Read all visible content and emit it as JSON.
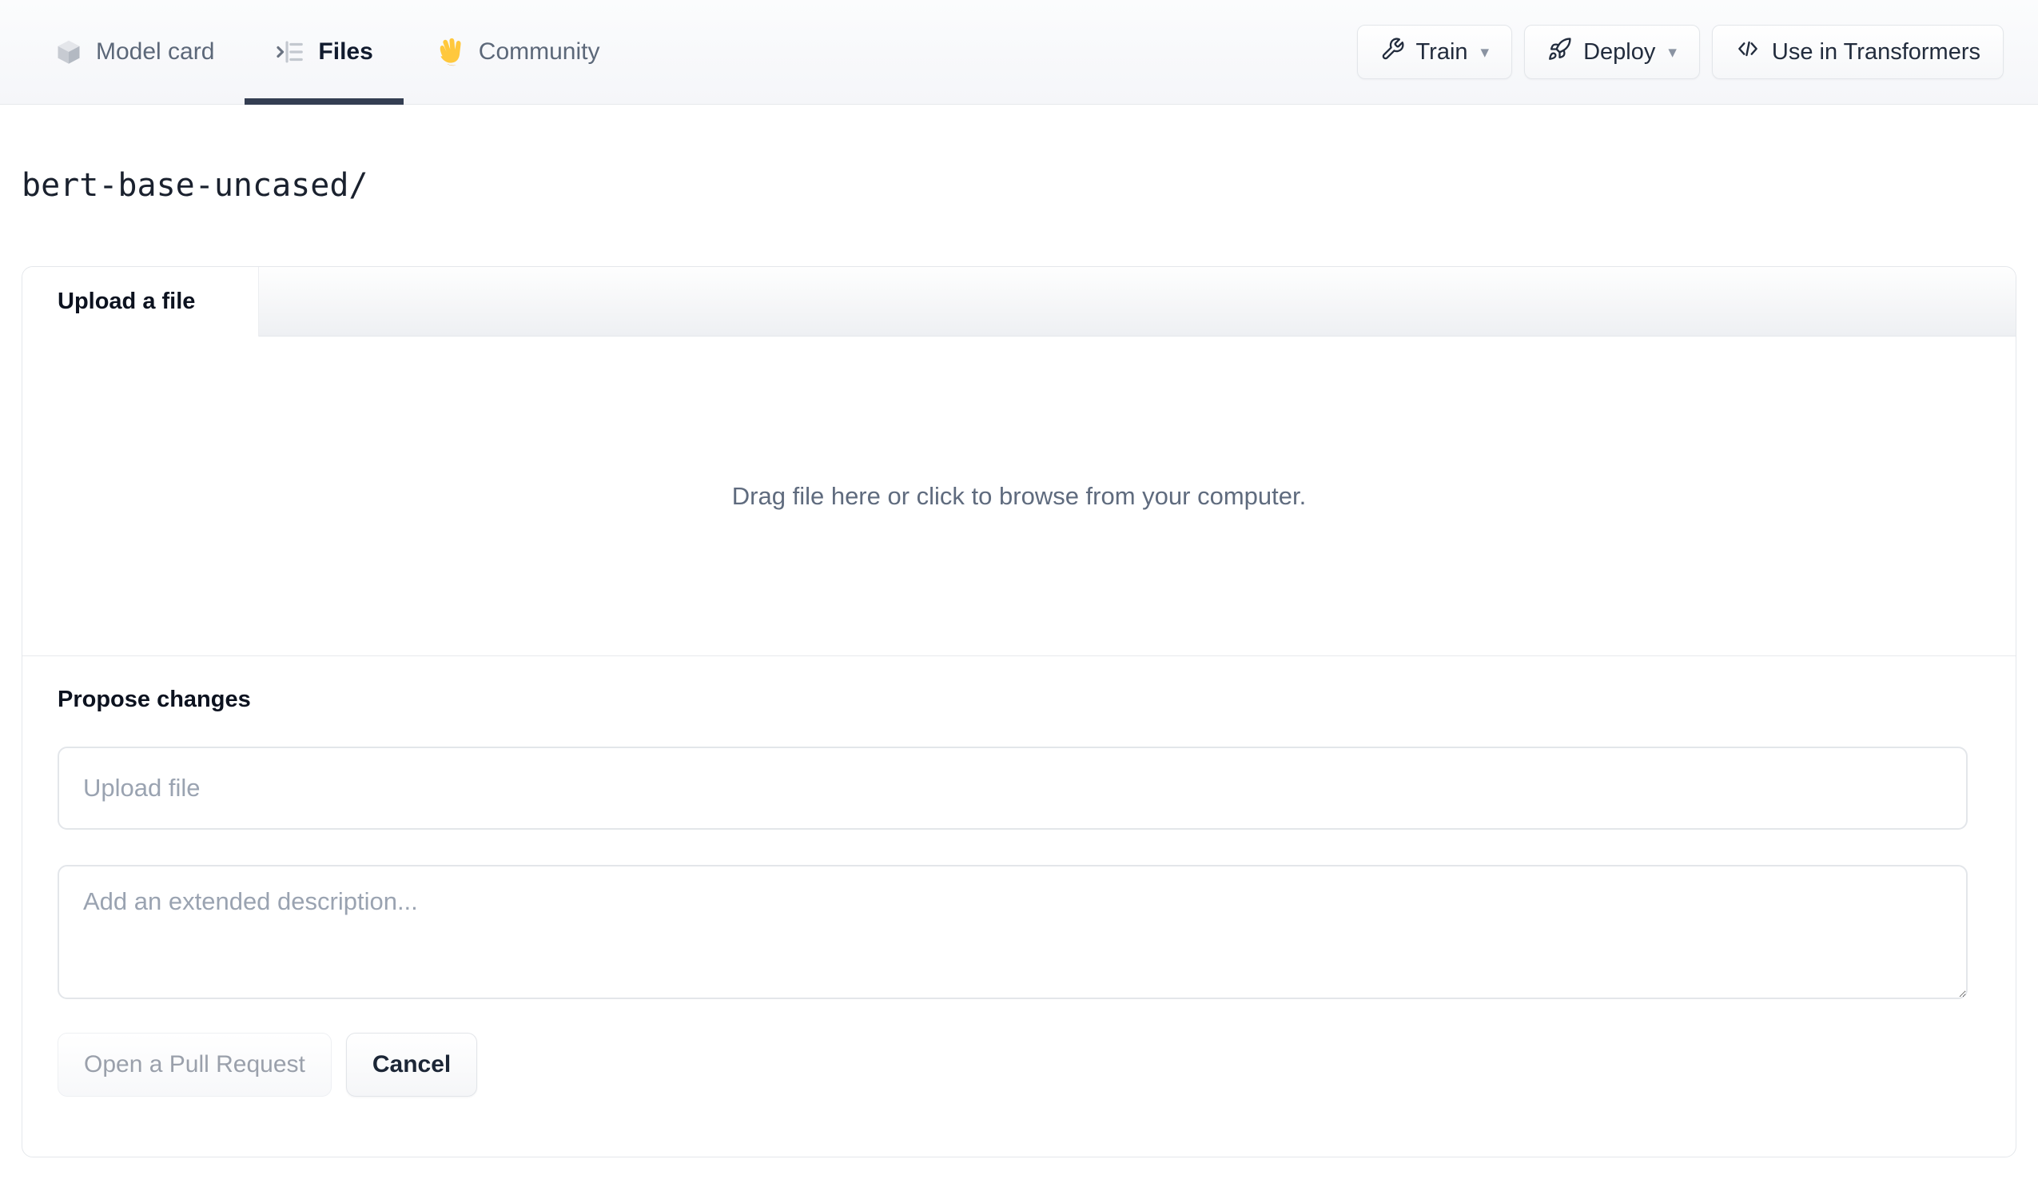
{
  "nav": {
    "tabs": [
      {
        "label": "Model card",
        "icon": "cube-icon",
        "active": false
      },
      {
        "label": "Files",
        "icon": "files-list-icon",
        "active": true
      },
      {
        "label": "Community",
        "icon": "waving-hand-emoji",
        "active": false
      }
    ],
    "actions": [
      {
        "label": "Train",
        "icon": "wrench-icon",
        "caret": "▾"
      },
      {
        "label": "Deploy",
        "icon": "rocket-icon",
        "caret": "▾"
      },
      {
        "label": "Use in Transformers",
        "icon": "code-icon",
        "caret": ""
      }
    ]
  },
  "breadcrumb": {
    "path": "bert-base-uncased/"
  },
  "upload_panel": {
    "tab_label": "Upload a file",
    "dropzone_text": "Drag file here or click to browse from your computer.",
    "propose": {
      "heading": "Propose changes",
      "filename_placeholder": "Upload file",
      "filename_value": "",
      "description_placeholder": "Add an extended description...",
      "description_value": "",
      "submit_label": "Open a Pull Request",
      "submit_enabled": false,
      "cancel_label": "Cancel"
    }
  },
  "colors": {
    "active_tab_underline": "#343e52",
    "nav_text": "#5c6879",
    "nav_text_active": "#111b2e",
    "panel_border": "#e4e7eb",
    "placeholder": "#9aa3b1",
    "dropzone_text": "#5f6b7e",
    "disabled_button_text": "#9aa0ab",
    "emoji_yellow": "#ffc83d"
  }
}
